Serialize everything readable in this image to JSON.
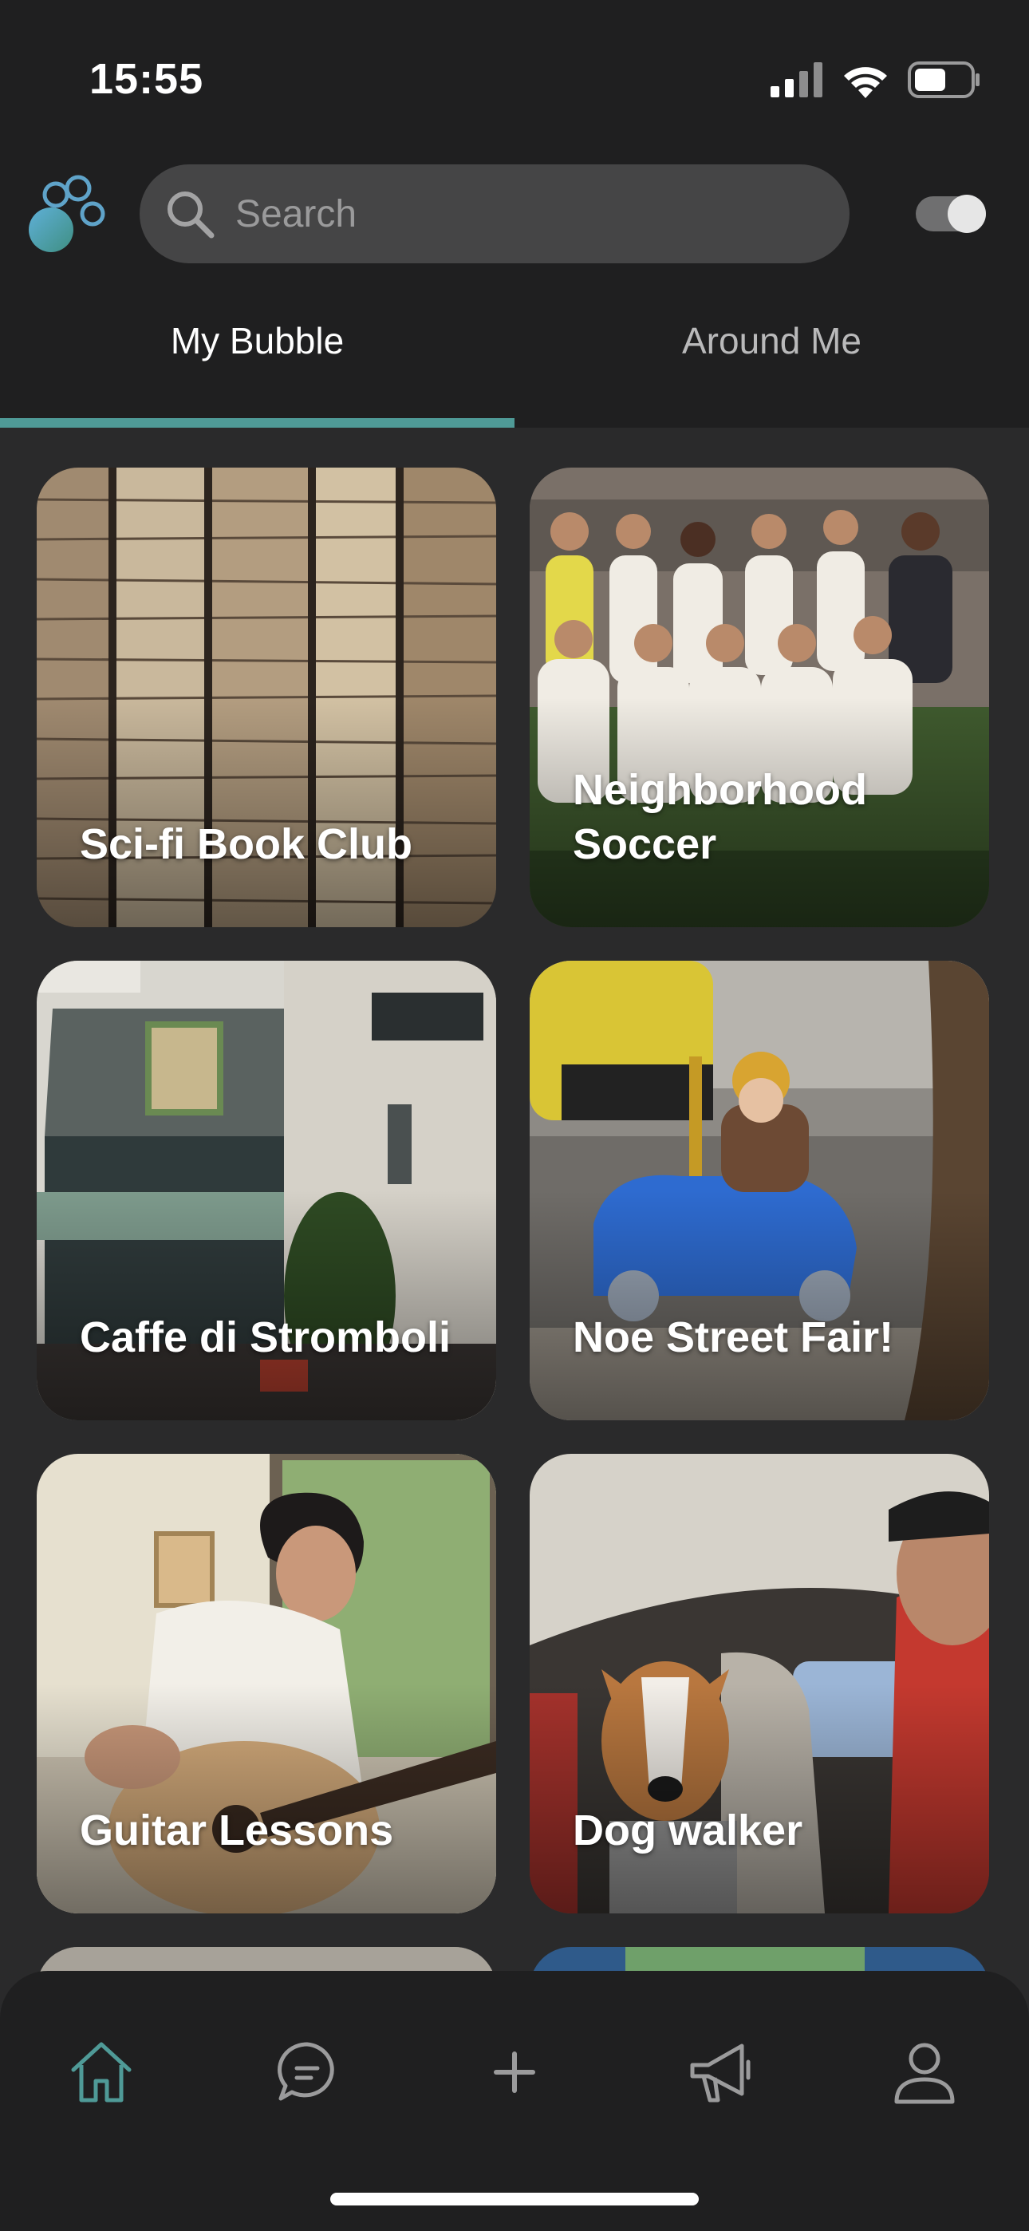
{
  "status_bar": {
    "time": "15:55"
  },
  "search": {
    "placeholder": "Search"
  },
  "tabs": [
    {
      "label": "My Bubble",
      "active": true
    },
    {
      "label": "Around Me",
      "active": false
    }
  ],
  "cards": [
    {
      "title": "Sci-fi Book Club"
    },
    {
      "title": "Neighborhood Soccer"
    },
    {
      "title": "Caffe di Stromboli"
    },
    {
      "title": "Noe Street Fair!"
    },
    {
      "title": "Guitar Lessons"
    },
    {
      "title": "Dog walker"
    }
  ],
  "bottom_nav": [
    {
      "icon": "home-icon",
      "active": true
    },
    {
      "icon": "chat-icon",
      "active": false
    },
    {
      "icon": "plus-icon",
      "active": false
    },
    {
      "icon": "megaphone-icon",
      "active": false
    },
    {
      "icon": "profile-icon",
      "active": false
    }
  ],
  "colors": {
    "accent": "#4f9a97",
    "background": "#2a2a2b",
    "bar": "#1f1f20",
    "search_field": "#454546"
  }
}
